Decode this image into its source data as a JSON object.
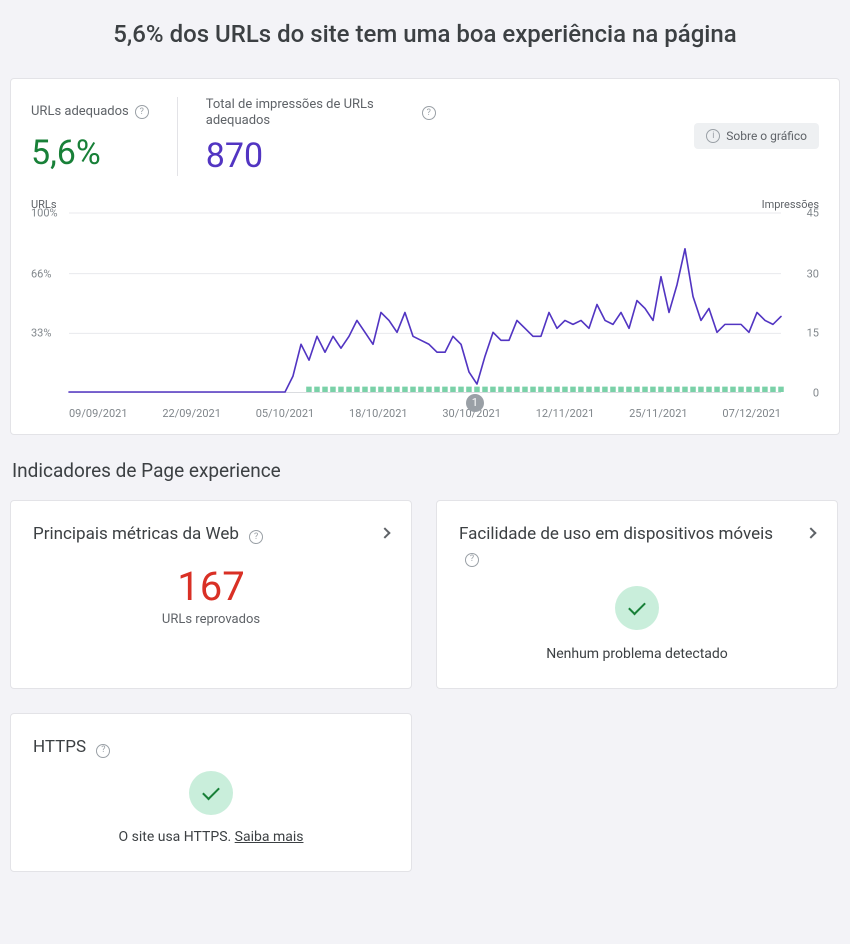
{
  "headline": "5,6% dos URLs do site tem uma boa experiência na página",
  "stats": {
    "good_urls_label": "URLs adequados",
    "good_urls_value": "5,6%",
    "impressions_label": "Total de impressões de URLs adequados",
    "impressions_value": "870",
    "about_chart": "Sobre o gráfico"
  },
  "chart": {
    "y_left_title": "URLs",
    "y_right_title": "Impressões",
    "y_left_ticks": [
      "100%",
      "66%",
      "33%"
    ],
    "y_right_ticks": [
      "45",
      "30",
      "15",
      "0"
    ],
    "x_ticks": [
      "09/09/2021",
      "22/09/2021",
      "05/10/2021",
      "18/10/2021",
      "30/10/2021",
      "12/11/2021",
      "25/11/2021",
      "07/12/2021"
    ],
    "event_label": "1"
  },
  "chart_data": {
    "type": "line",
    "title": "",
    "xlabel": "",
    "ylabel_left": "URLs (%)",
    "ylabel_right": "Impressões",
    "ylim_left": [
      0,
      100
    ],
    "ylim_right": [
      0,
      45
    ],
    "x": [
      "09/09",
      "10/09",
      "11/09",
      "12/09",
      "13/09",
      "14/09",
      "15/09",
      "16/09",
      "17/09",
      "18/09",
      "19/09",
      "20/09",
      "21/09",
      "22/09",
      "23/09",
      "24/09",
      "25/09",
      "26/09",
      "27/09",
      "28/09",
      "29/09",
      "30/09",
      "01/10",
      "02/10",
      "03/10",
      "04/10",
      "05/10",
      "06/10",
      "07/10",
      "08/10",
      "09/10",
      "10/10",
      "11/10",
      "12/10",
      "13/10",
      "14/10",
      "15/10",
      "16/10",
      "17/10",
      "18/10",
      "19/10",
      "20/10",
      "21/10",
      "22/10",
      "23/10",
      "24/10",
      "25/10",
      "26/10",
      "27/10",
      "28/10",
      "29/10",
      "30/10",
      "31/10",
      "01/11",
      "02/11",
      "03/11",
      "04/11",
      "05/11",
      "06/11",
      "07/11",
      "08/11",
      "09/11",
      "10/11",
      "11/11",
      "12/11",
      "13/11",
      "14/11",
      "15/11",
      "16/11",
      "17/11",
      "18/11",
      "19/11",
      "20/11",
      "21/11",
      "22/11",
      "23/11",
      "24/11",
      "25/11",
      "26/11",
      "27/11",
      "28/11",
      "29/11",
      "30/11",
      "01/12",
      "02/12",
      "03/12",
      "04/12",
      "05/12",
      "06/12",
      "07/12"
    ],
    "series": [
      {
        "name": "Impressões de URLs adequados",
        "axis": "right",
        "values": [
          0,
          0,
          0,
          0,
          0,
          0,
          0,
          0,
          0,
          0,
          0,
          0,
          0,
          0,
          0,
          0,
          0,
          0,
          0,
          0,
          0,
          0,
          0,
          0,
          0,
          0,
          0,
          0,
          4,
          12,
          8,
          14,
          10,
          14,
          11,
          14,
          18,
          15,
          12,
          20,
          18,
          15,
          20,
          14,
          13,
          12,
          10,
          10,
          14,
          12,
          5,
          2,
          9,
          15,
          13,
          13,
          18,
          16,
          14,
          14,
          20,
          16,
          18,
          17,
          18,
          16,
          22,
          18,
          17,
          20,
          16,
          23,
          21,
          18,
          29,
          20,
          27,
          36,
          24,
          18,
          21,
          15,
          17,
          17,
          17,
          15,
          20,
          18,
          17,
          19
        ]
      },
      {
        "name": "URLs adequados (%)",
        "axis": "left",
        "values": [
          0,
          0,
          0,
          0,
          0,
          0,
          0,
          0,
          0,
          0,
          0,
          0,
          0,
          0,
          0,
          0,
          0,
          0,
          0,
          0,
          0,
          0,
          0,
          0,
          0,
          0,
          0,
          0,
          0,
          0,
          3,
          3,
          3,
          3,
          3,
          3,
          3,
          3,
          3,
          3,
          3,
          3,
          3,
          3,
          3,
          3,
          3,
          3,
          3,
          3,
          3,
          3,
          3,
          3,
          3,
          3,
          3,
          3,
          3,
          3,
          3,
          3,
          3,
          3,
          3,
          3,
          3,
          3,
          3,
          3,
          3,
          3,
          3,
          3,
          3,
          3,
          3,
          3,
          3,
          3,
          3,
          3,
          3,
          3,
          3,
          3,
          3,
          3,
          3,
          3
        ]
      }
    ],
    "annotations": [
      {
        "x": "30/10",
        "label": "1"
      }
    ]
  },
  "section_title": "Indicadores de Page experience",
  "cards": {
    "cwv": {
      "title": "Principais métricas da Web",
      "value": "167",
      "sub": "URLs reprovados"
    },
    "mobile": {
      "title": "Facilidade de uso em dispositivos móveis",
      "status": "Nenhum problema detectado"
    },
    "https": {
      "title": "HTTPS",
      "status": "O site usa HTTPS. ",
      "more": "Saiba mais"
    }
  }
}
